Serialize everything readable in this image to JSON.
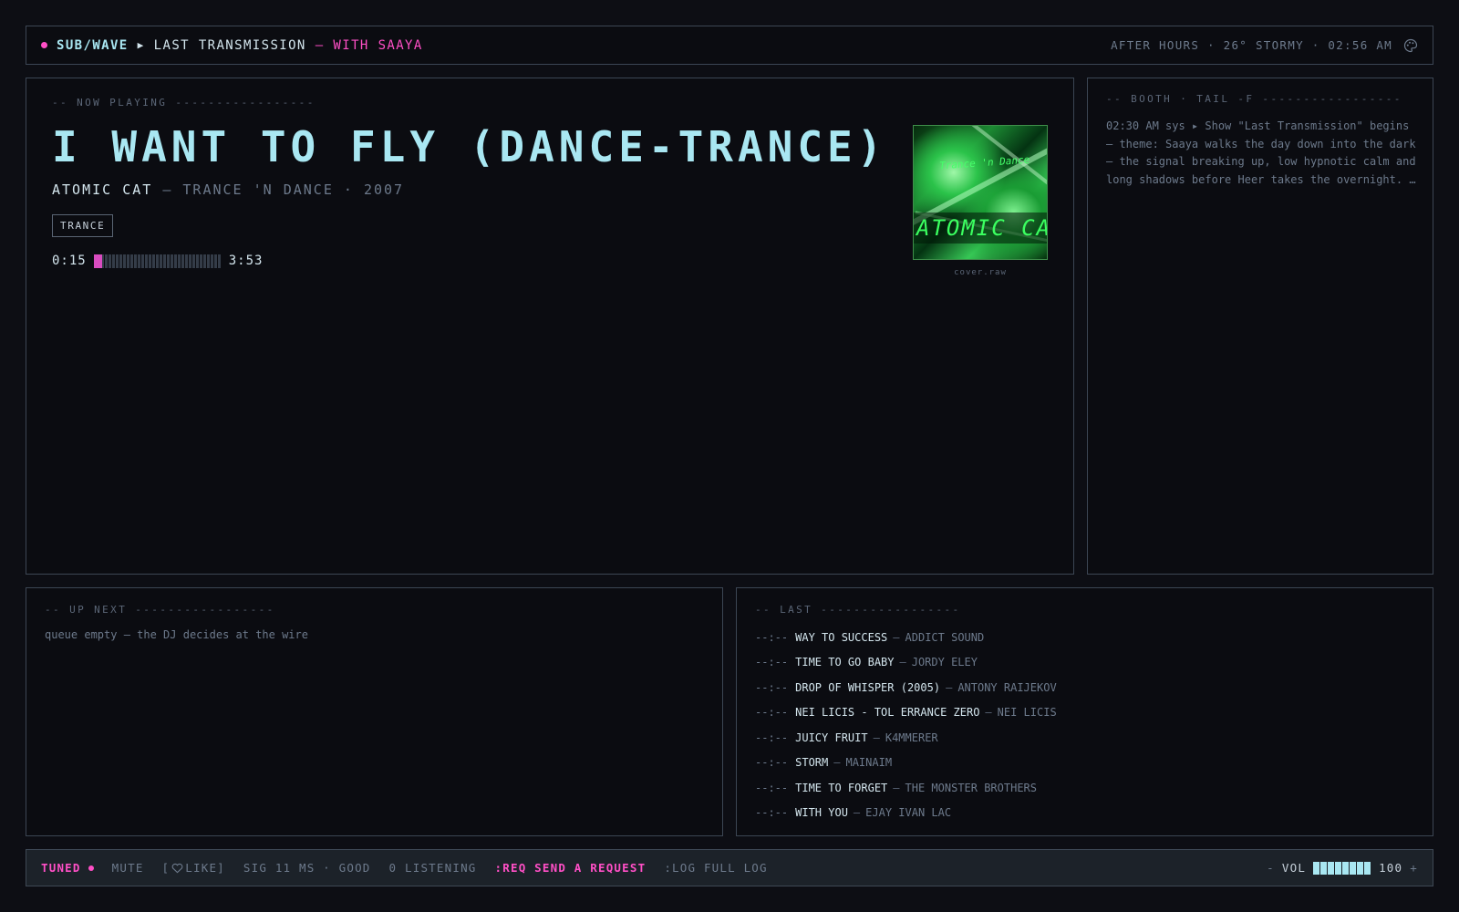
{
  "topbar": {
    "brand": "SUB/WAVE",
    "show": "LAST TRANSMISSION",
    "host": "— WITH SAAYA",
    "status": "AFTER HOURS · 26° STORMY · 02:56 AM",
    "icon": "palette-icon"
  },
  "now_playing": {
    "label": "-- NOW PLAYING -----------------",
    "title": "I WANT TO FLY (DANCE-TRANCE)",
    "artist": "ATOMIC CAT",
    "album_year": "— TRANCE 'N DANCE · 2007",
    "tag": "TRANCE",
    "elapsed": "0:15",
    "duration": "3:53",
    "progress_fraction": 0.064,
    "cover": {
      "small_text": "Trance 'n Dance",
      "big_text": "ATOMIC CAT",
      "caption": "cover.raw"
    }
  },
  "booth": {
    "label": "-- BOOTH · TAIL -F -----------------",
    "log": "02:30 AM sys ▸ Show \"Last Transmission\" begins — theme: Saaya walks the day down into the dark — the signal breaking up, low hypnotic calm and long shadows before Heer takes the overnight. …"
  },
  "up_next": {
    "label": "-- UP NEXT -----------------",
    "empty_text": "queue empty — the DJ decides at the wire"
  },
  "last": {
    "label": "-- LAST -----------------",
    "items": [
      {
        "time": "--:--",
        "song": "WAY TO SUCCESS",
        "artist": "ADDICT SOUND"
      },
      {
        "time": "--:--",
        "song": "TIME TO GO BABY",
        "artist": "JORDY ELEY"
      },
      {
        "time": "--:--",
        "song": "DROP OF WHISPER (2005)",
        "artist": "ANTONY RAIJEKOV"
      },
      {
        "time": "--:--",
        "song": "NEI LICIS - TOL ERRANCE ZERO",
        "artist": "NEI LICIS"
      },
      {
        "time": "--:--",
        "song": "JUICY FRUIT",
        "artist": "K4MMERER"
      },
      {
        "time": "--:--",
        "song": "STORM",
        "artist": "MAINAIM"
      },
      {
        "time": "--:--",
        "song": "TIME TO FORGET",
        "artist": "THE MONSTER BROTHERS"
      },
      {
        "time": "--:--",
        "song": "WITH YOU",
        "artist": "EJAY IVAN LAC"
      }
    ]
  },
  "status": {
    "tuned": "TUNED",
    "mute": "MUTE",
    "like_open": "[",
    "like_label": "LIKE]",
    "signal": "SIG 11 MS · GOOD",
    "listening": "0 LISTENING",
    "request": ":REQ SEND A REQUEST",
    "log": ":LOG FULL LOG",
    "vol_minus": "-",
    "vol_label": "VOL",
    "vol_value": "100",
    "vol_plus": "+",
    "vol_fraction": 1.0
  },
  "colors": {
    "accent_pink": "#ff4fc6",
    "accent_cyan": "#a9e7f2",
    "background": "#0d0e14",
    "cover_green": "#3bff60"
  }
}
